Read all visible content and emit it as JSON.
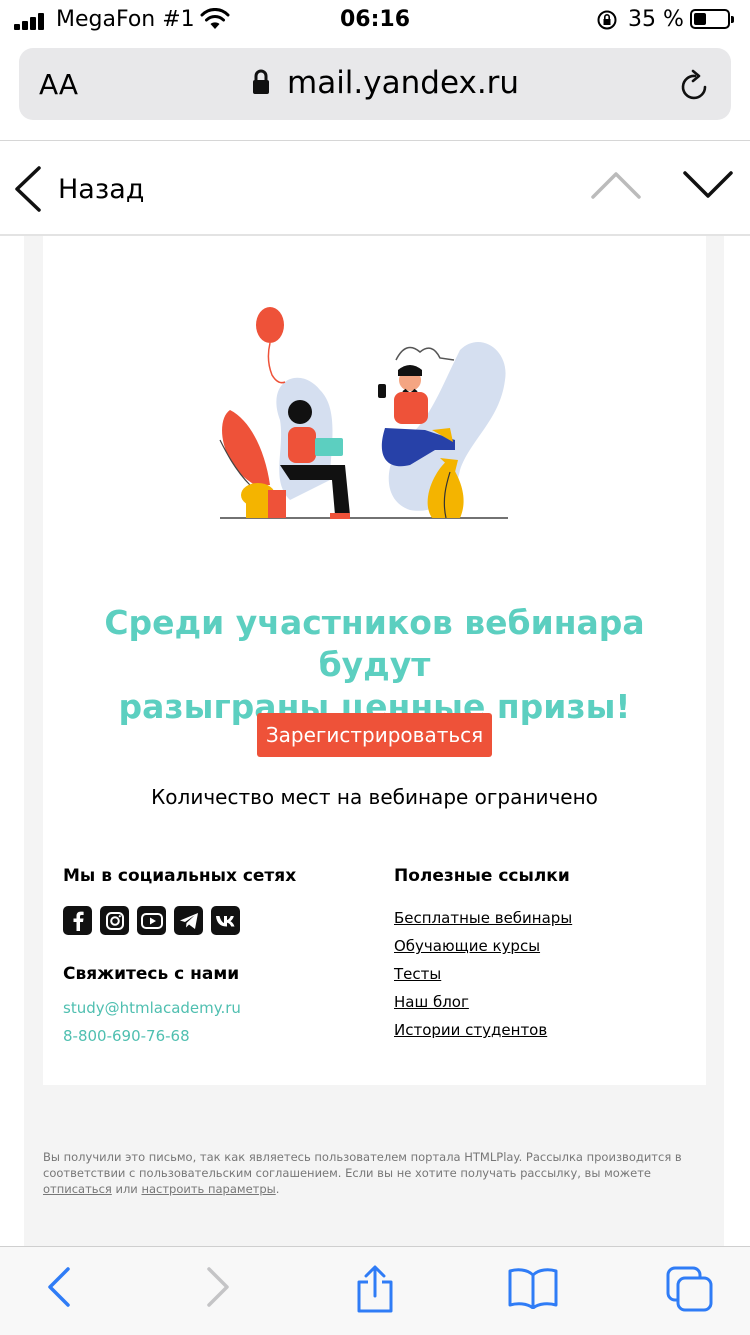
{
  "status": {
    "carrier": "MegaFon #1",
    "time": "06:16",
    "battery": "35 %"
  },
  "browser": {
    "text_size": "AA",
    "url": "mail.yandex.ru"
  },
  "header": {
    "back_label": "Назад"
  },
  "mail": {
    "headline_1": "Среди участников вебинара будут",
    "headline_2": "разыграны ценные призы!",
    "cta_label": "Зарегистрироваться",
    "limited": "Количество мест на вебинаре ограничено",
    "social_title": "Мы в социальных сетях",
    "contact_title": "Свяжитесь с нами",
    "email": "study@htmlacademy.ru",
    "phone": "8-800-690-76-68",
    "links_title": "Полезные ссылки",
    "links": [
      "Бесплатные вебинары",
      "Обучающие курсы",
      "Тесты",
      "Наш блог",
      "Истории студентов"
    ],
    "footnote": {
      "text_1": "Вы получили это письмо, так как являетесь пользователем портала HTMLPlay. Рассылка производится в соответствии с пользовательским соглашением. Если вы не хотите получать рассылку, вы можете",
      "unsubscribe": "отписаться",
      "or": "или",
      "settings": "настроить параметры",
      "end": "."
    }
  },
  "colors": {
    "accent_teal": "#5ccfc0",
    "cta": "#ee5239",
    "ios_blue": "#2f7cf6"
  }
}
